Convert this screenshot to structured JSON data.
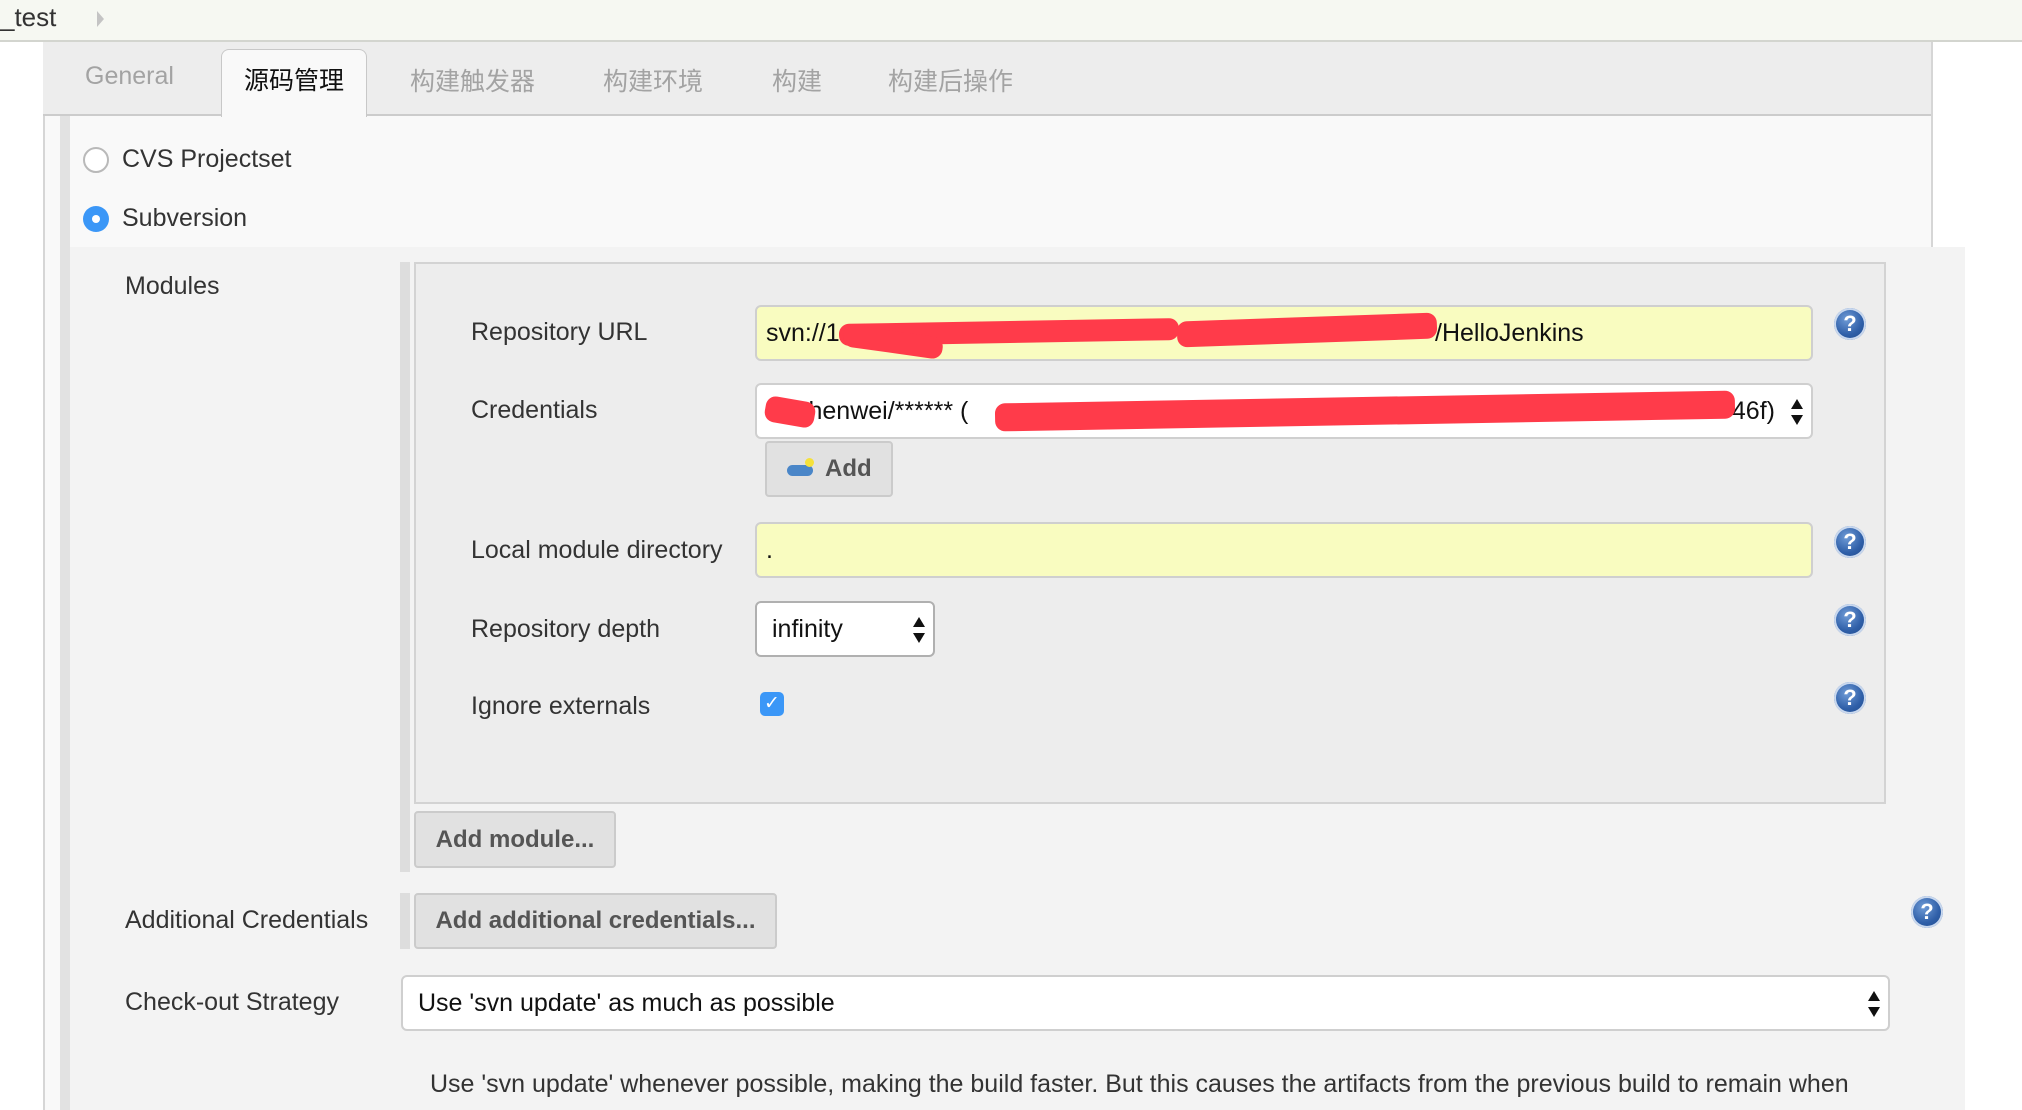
{
  "header": {
    "breadcrumb": "_test",
    "breadcrumb_arrow_icon": "triangle-right-icon"
  },
  "tabs": [
    {
      "label": "General",
      "active": false
    },
    {
      "label": "源码管理",
      "active": true
    },
    {
      "label": "构建触发器",
      "active": false
    },
    {
      "label": "构建环境",
      "active": false
    },
    {
      "label": "构建",
      "active": false
    },
    {
      "label": "构建后操作",
      "active": false
    }
  ],
  "scm": {
    "options": [
      {
        "label": "CVS Projectset",
        "checked": false
      },
      {
        "label": "Subversion",
        "checked": true
      }
    ]
  },
  "modules": {
    "label": "Modules",
    "repository_url": {
      "label": "Repository URL",
      "value_prefix": "svn://1",
      "value_suffix": "/HelloJenkins",
      "redacted": true
    },
    "credentials": {
      "label": "Credentials",
      "value_visible": "zhenwei/****** (",
      "value_end": "46f)",
      "redacted": true,
      "add_button": "Add",
      "add_icon": "key-icon"
    },
    "local_module_directory": {
      "label": "Local module directory",
      "value": "."
    },
    "repository_depth": {
      "label": "Repository depth",
      "value": "infinity"
    },
    "ignore_externals": {
      "label": "Ignore externals",
      "checked": true
    },
    "add_module_button": "Add module..."
  },
  "additional_credentials": {
    "label": "Additional Credentials",
    "button": "Add additional credentials..."
  },
  "checkout_strategy": {
    "label": "Check-out Strategy",
    "value": "Use 'svn update' as much as possible",
    "description": "Use 'svn update' whenever possible, making the build faster. But this causes the artifacts from the previous build to remain when"
  },
  "help_icon": "?"
}
